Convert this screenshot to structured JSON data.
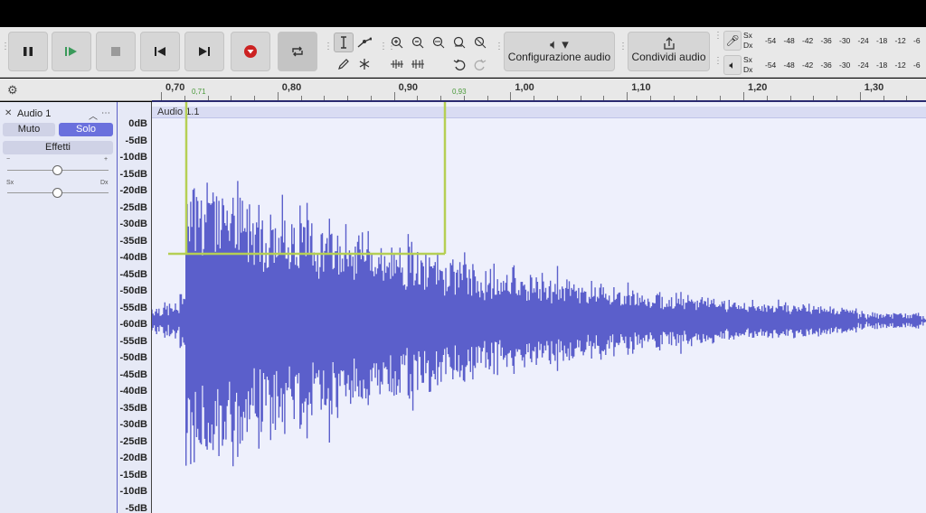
{
  "transport": {
    "pause": "pause-icon",
    "play_at_speed": "play-icon",
    "stop": "stop-icon",
    "skip_start": "skip-start-icon",
    "skip_end": "skip-end-icon",
    "record": "record-icon",
    "loop": "loop-icon"
  },
  "buttons": {
    "audio_setup": "Configurazione audio",
    "share_audio": "Condividi audio"
  },
  "meters": {
    "channels": [
      "Sx",
      "Dx"
    ],
    "scale": [
      "-54",
      "-48",
      "-42",
      "-36",
      "-30",
      "-24",
      "-18",
      "-12",
      "-6"
    ]
  },
  "ruler": {
    "ticks": [
      "0,70",
      "0,80",
      "0,90",
      "1,00",
      "1,10",
      "1,20",
      "1,30"
    ],
    "selection_start": "0,71",
    "selection_end": "0,93"
  },
  "track": {
    "name": "Audio 1",
    "mute": "Muto",
    "solo": "Solo",
    "effects": "Effetti",
    "gain_minus": "−",
    "gain_plus": "+",
    "pan_left": "Sx",
    "pan_right": "Dx",
    "clip_name": "Audio 1.1",
    "gain_level": 0.5,
    "pan_level": 0.5
  },
  "db_scale": [
    "0dB",
    "-5dB",
    "-10dB",
    "-15dB",
    "-20dB",
    "-25dB",
    "-30dB",
    "-35dB",
    "-40dB",
    "-45dB",
    "-50dB",
    "-55dB",
    "-60dB",
    "-55dB",
    "-50dB",
    "-45dB",
    "-40dB",
    "-35dB",
    "-30dB",
    "-25dB",
    "-20dB",
    "-15dB",
    "-10dB",
    "-5dB"
  ],
  "colors": {
    "waveform": "#5b5fcb",
    "selection_marker": "#b5cf54",
    "record": "#cc2222",
    "play": "#3a9a5a",
    "solo_active": "#6a70dd"
  }
}
